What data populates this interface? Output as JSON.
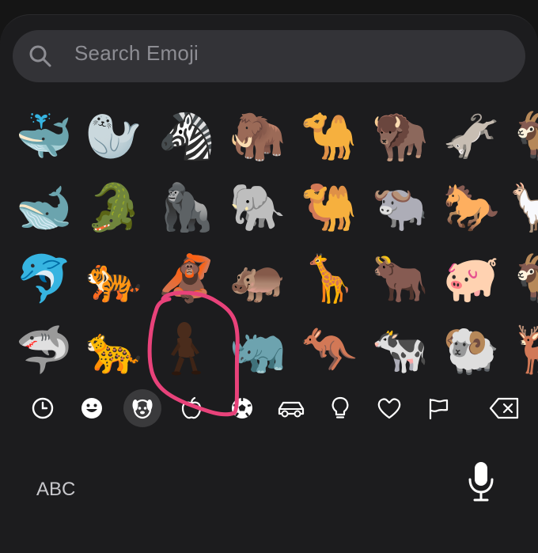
{
  "search": {
    "placeholder": "Search Emoji"
  },
  "emoji_grid": {
    "rows": [
      [
        "🐳",
        "🦭",
        "🦓",
        "🦣",
        "🐪",
        "🦬",
        "🫏",
        "🐐"
      ],
      [
        "🐋",
        "🐊",
        "🦍",
        "🐘",
        "🐫",
        "🐃",
        "🐎",
        "🦙"
      ],
      [
        "🐬",
        "🐅",
        "🦧",
        "🦛",
        "🦒",
        "🐂",
        "🐖",
        "🐐"
      ],
      [
        "🦈",
        "🐆",
        "",
        "🦏",
        "🦘",
        "🐄",
        "🐏",
        "🦌"
      ]
    ]
  },
  "categories": [
    {
      "icon": "clock-icon",
      "selected": false
    },
    {
      "icon": "smiley-icon",
      "selected": false
    },
    {
      "icon": "animal-icon",
      "selected": true
    },
    {
      "icon": "apple-icon",
      "selected": false
    },
    {
      "icon": "soccer-ball-icon",
      "selected": false
    },
    {
      "icon": "car-icon",
      "selected": false
    },
    {
      "icon": "lightbulb-icon",
      "selected": false
    },
    {
      "icon": "heart-icon",
      "selected": false
    },
    {
      "icon": "flag-icon",
      "selected": false
    },
    {
      "icon": "delete-icon",
      "selected": false
    }
  ],
  "bottom": {
    "abc_label": "ABC"
  },
  "colors": {
    "annotation": "#e8427a",
    "background": "#1c1c1e"
  }
}
